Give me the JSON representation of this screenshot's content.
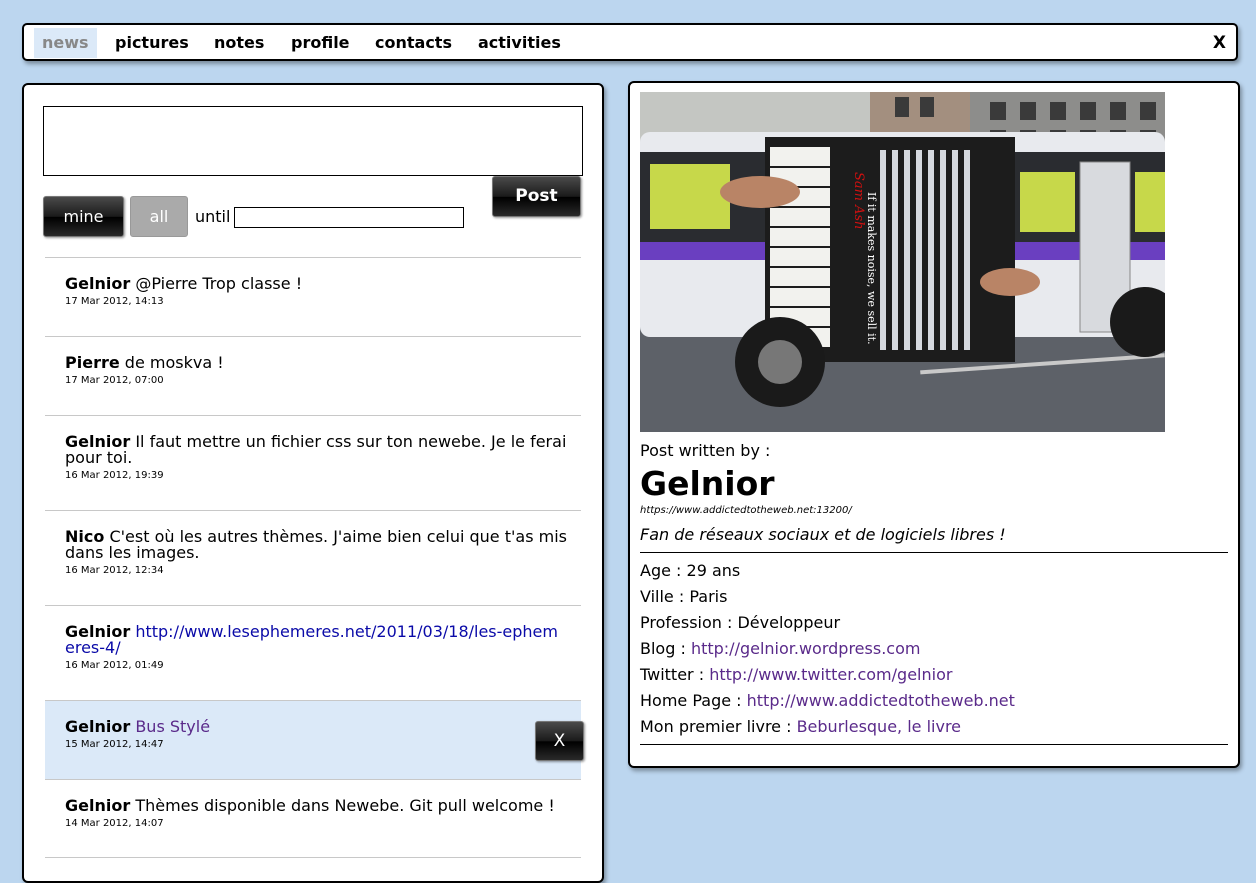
{
  "nav": {
    "tabs": [
      {
        "label": "news",
        "active": true
      },
      {
        "label": "pictures",
        "active": false
      },
      {
        "label": "notes",
        "active": false
      },
      {
        "label": "profile",
        "active": false
      },
      {
        "label": "contacts",
        "active": false
      },
      {
        "label": "activities",
        "active": false
      }
    ],
    "close_label": "X"
  },
  "composer": {
    "post_label": "Post",
    "mine_label": "mine",
    "all_label": "all",
    "until_label": "until",
    "until_value": ""
  },
  "feed": [
    {
      "author": "Gelnior",
      "text": "@Pierre Trop classe !",
      "date": "17 Mar 2012, 14:13",
      "text_type": "plain"
    },
    {
      "author": "Pierre",
      "text": "de moskva !",
      "date": "17 Mar 2012, 07:00",
      "text_type": "plain"
    },
    {
      "author": "Gelnior",
      "text": "Il faut mettre un fichier css sur ton newebe. Je le ferai pour toi.",
      "date": "16 Mar 2012, 19:39",
      "text_type": "plain"
    },
    {
      "author": "Nico",
      "text": "C'est où les autres thèmes. J'aime bien celui que t'as mis dans les images.",
      "date": "16 Mar 2012, 12:34",
      "text_type": "plain"
    },
    {
      "author": "Gelnior",
      "text": "http://www.lesephemeres.net/2011/03/18/les-ephemeres-4/",
      "date": "16 Mar 2012, 01:49",
      "text_type": "link"
    },
    {
      "author": "Gelnior",
      "text": "Bus Stylé",
      "date": "15 Mar 2012, 14:47",
      "text_type": "visited",
      "selected": true,
      "delete_label": "X"
    },
    {
      "author": "Gelnior",
      "text": "Thèmes disponible dans Newebe. Git pull welcome !",
      "date": "14 Mar 2012, 14:07",
      "text_type": "plain"
    }
  ],
  "detail": {
    "written_by_label": "Post written by :",
    "author_name": "Gelnior",
    "author_url": "https://www.addictedtotheweb.net:13200/",
    "tagline": "Fan de réseaux sociaux et de logiciels libres !",
    "image_text": "If it makes noise, we sell it.",
    "image_brand": "Sam Ash",
    "fields": [
      {
        "label": "Age : ",
        "value": "29 ans",
        "is_link": false
      },
      {
        "label": "Ville : ",
        "value": "Paris",
        "is_link": false
      },
      {
        "label": "Profession : ",
        "value": "Développeur",
        "is_link": false
      },
      {
        "label": "Blog : ",
        "value": "http://gelnior.wordpress.com",
        "is_link": true
      },
      {
        "label": "Twitter : ",
        "value": "http://www.twitter.com/gelnior",
        "is_link": true
      },
      {
        "label": "Home Page : ",
        "value": "http://www.addictedtotheweb.net",
        "is_link": true
      },
      {
        "label": "Mon premier livre : ",
        "value": "Beburlesque, le livre",
        "is_link": true
      }
    ]
  },
  "colors": {
    "background": "#bcd6ef",
    "selected_row": "#dbe9f8",
    "link": "#0a0aa8",
    "visited_link": "#5a2a8a"
  }
}
